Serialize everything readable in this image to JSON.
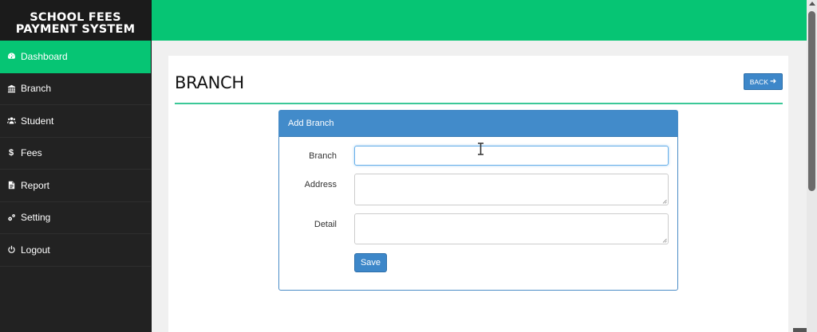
{
  "app": {
    "title_line1": "SCHOOL FEES",
    "title_line2": "PAYMENT SYSTEM"
  },
  "sidebar": {
    "items": [
      {
        "label": "Dashboard",
        "icon": "dashboard-icon",
        "active": true
      },
      {
        "label": "Branch",
        "icon": "bank-icon"
      },
      {
        "label": "Student",
        "icon": "users-icon"
      },
      {
        "label": "Fees",
        "icon": "dollar-icon"
      },
      {
        "label": "Report",
        "icon": "document-icon"
      },
      {
        "label": "Setting",
        "icon": "gears-icon"
      },
      {
        "label": "Logout",
        "icon": "power-icon"
      }
    ]
  },
  "page": {
    "title": "BRANCH",
    "back_label": "BACK",
    "back_icon": "arrow-right-icon"
  },
  "form": {
    "header": "Add Branch",
    "fields": {
      "branch": {
        "label": "Branch",
        "value": ""
      },
      "address": {
        "label": "Address",
        "value": ""
      },
      "detail": {
        "label": "Detail",
        "value": ""
      }
    },
    "save_label": "Save"
  },
  "colors": {
    "accent_green": "#06c574",
    "primary_blue": "#428bca",
    "sidebar_bg": "#222222"
  }
}
